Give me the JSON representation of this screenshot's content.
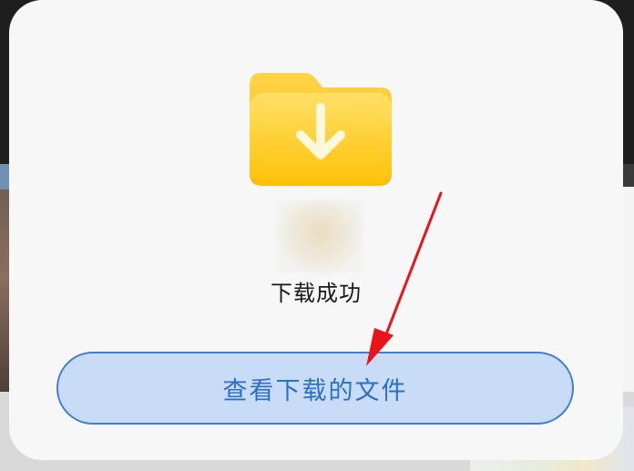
{
  "dialog": {
    "status_text": "下载成功",
    "view_button_label": "查看下载的文件",
    "icon": "download-folder-icon"
  },
  "colors": {
    "folder_yellow": "#ffc91a",
    "button_fill": "#c8dcf7",
    "button_border": "#3f7fd0",
    "button_text": "#2a6fc9",
    "annotation_arrow": "#e8141c"
  }
}
